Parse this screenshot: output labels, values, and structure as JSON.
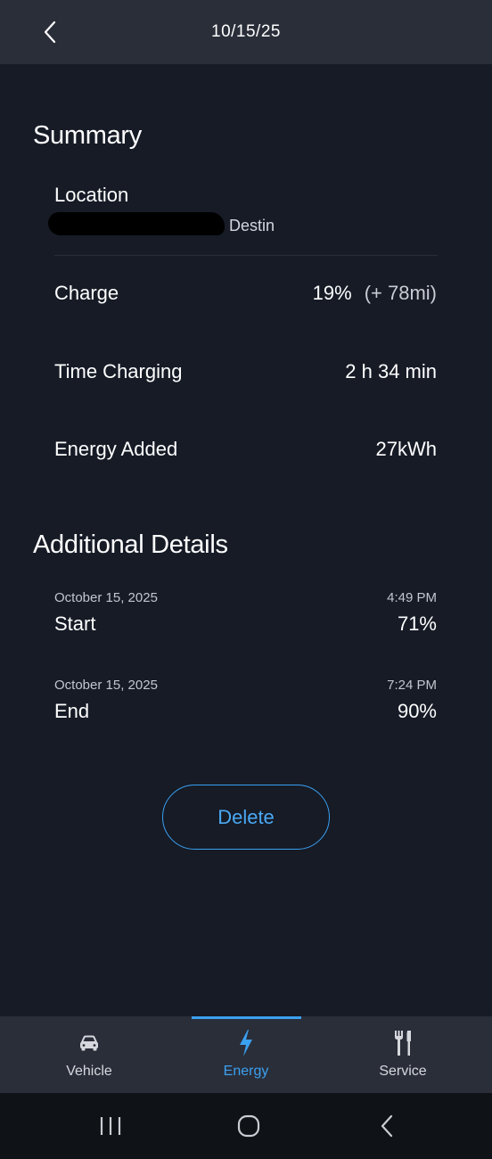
{
  "header": {
    "title": "10/15/25"
  },
  "summary": {
    "title": "Summary",
    "location_label": "Location",
    "location_value": "Destin",
    "charge_label": "Charge",
    "charge_percent": "19%",
    "charge_range": "(+ 78mi)",
    "time_label": "Time Charging",
    "time_value": "2 h 34 min",
    "energy_label": "Energy Added",
    "energy_value": "27kWh"
  },
  "details": {
    "title": "Additional Details",
    "start": {
      "date": "October 15, 2025",
      "time": "4:49 PM",
      "label": "Start",
      "value": "71%"
    },
    "end": {
      "date": "October 15, 2025",
      "time": "7:24 PM",
      "label": "End",
      "value": "90%"
    }
  },
  "delete_label": "Delete",
  "tabs": [
    {
      "label": "Vehicle",
      "icon": "car-icon"
    },
    {
      "label": "Energy",
      "icon": "lightning-icon",
      "active": true
    },
    {
      "label": "Service",
      "icon": "tools-icon"
    }
  ],
  "colors": {
    "accent": "#3aa0f0",
    "background": "#161b26",
    "bar": "#2a2e39"
  }
}
